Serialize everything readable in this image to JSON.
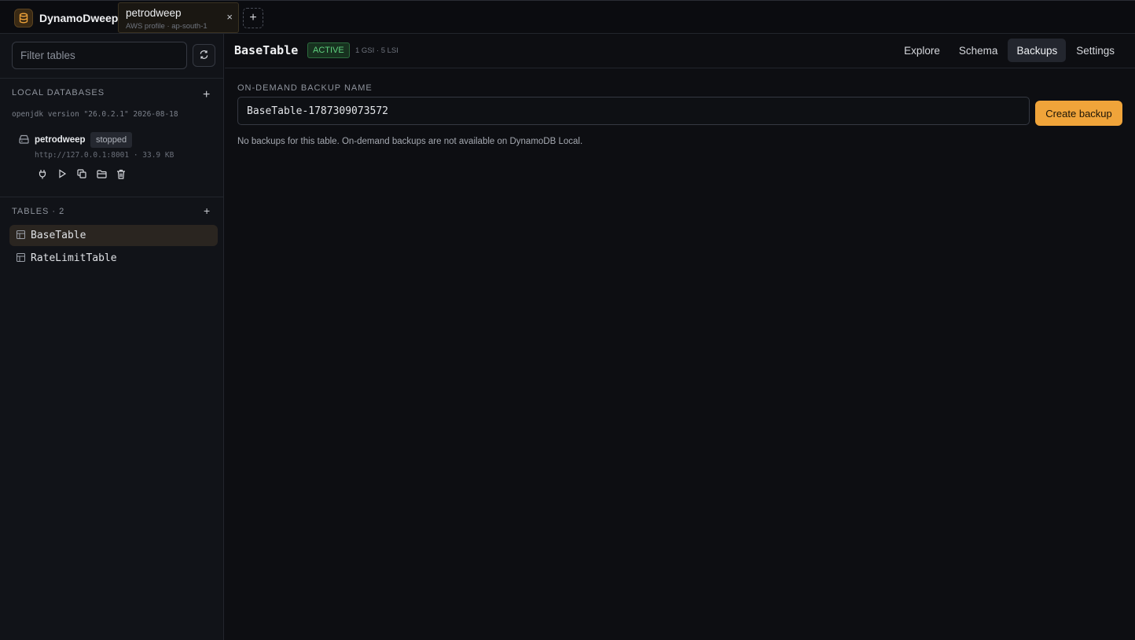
{
  "app": {
    "name": "DynamoDweep"
  },
  "tabs": [
    {
      "title": "petrodweep",
      "subtitle": "AWS profile · ap-south-1",
      "close": "×"
    }
  ],
  "new_tab_label": "+",
  "sidebar": {
    "filter_placeholder": "Filter tables",
    "local_databases_title": "LOCAL DATABASES",
    "java_version": "openjdk version \"26.0.2.1\" 2026-08-18",
    "database": {
      "name": "petrodweep",
      "status": "stopped",
      "url": "http://127.0.0.1:8001 · 33.9 KB"
    },
    "tables_title": "TABLES · 2",
    "tables": [
      {
        "name": "BaseTable"
      },
      {
        "name": "RateLimitTable"
      }
    ]
  },
  "main": {
    "table_name": "BaseTable",
    "status": "ACTIVE",
    "index_info": "1 GSI · 5 LSI",
    "nav": [
      "Explore",
      "Schema",
      "Backups",
      "Settings"
    ],
    "active_nav": "Backups",
    "backup_label": "ON-DEMAND BACKUP NAME",
    "backup_value": "BaseTable-1787309073572",
    "create_button": "Create backup",
    "note": "No backups for this table. On-demand backups are not available on DynamoDB Local."
  },
  "colors": {
    "accent": "#f0a43a",
    "status_active": "#5fd07e",
    "background": "#0d0e12"
  },
  "icons": {
    "brand": "database-icon",
    "refresh": "refresh-icon",
    "db": "server-icon",
    "actions": [
      "plug-icon",
      "play-icon",
      "copy-icon",
      "folder-icon",
      "trash-icon"
    ],
    "table": "table-icon"
  }
}
